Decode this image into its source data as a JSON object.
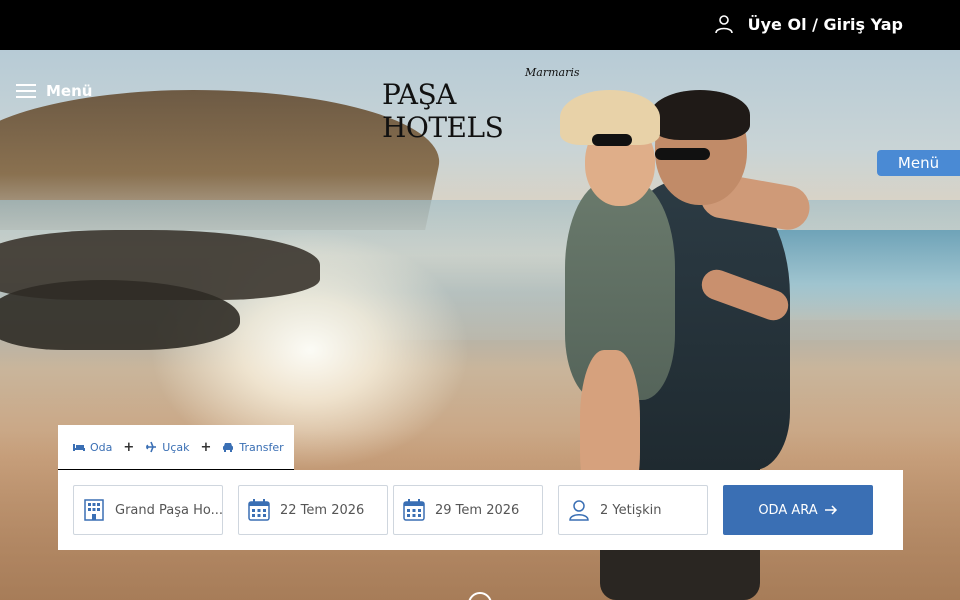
{
  "topbar": {
    "login_label": "Üye Ol / Giriş Yap"
  },
  "header": {
    "menu_label": "Menü",
    "logo_main": "PAŞA HOTELS",
    "logo_sub": "Marmaris",
    "side_menu_label": "Menü"
  },
  "booking": {
    "tabs": [
      {
        "label": "Oda",
        "icon": "bed-icon"
      },
      {
        "label": "Uçak",
        "icon": "plane-icon"
      },
      {
        "label": "Transfer",
        "icon": "car-icon"
      }
    ],
    "hotel": "Grand Paşa Ho...",
    "checkin": "22 Tem 2026",
    "checkout": "29 Tem 2026",
    "guests": "2 Yetişkin",
    "search_label": "ODA ARA"
  },
  "colors": {
    "accent": "#3a6fb4",
    "side_tab": "#4a8ad4",
    "topbar": "#000000"
  }
}
